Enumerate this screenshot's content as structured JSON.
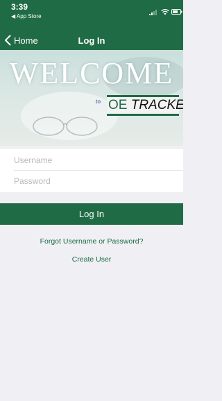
{
  "status_bar": {
    "time": "3:39",
    "back_to_app": "◀ App Store"
  },
  "navbar": {
    "back_label": "Home",
    "title": "Log In"
  },
  "hero": {
    "welcome": "WELCOME",
    "to": "to",
    "brand_prefix": "OE",
    "brand_suffix": " TRACKER"
  },
  "form": {
    "username_placeholder": "Username",
    "password_placeholder": "Password",
    "login_label": "Log In"
  },
  "links": {
    "forgot": "Forgot Username or Password?",
    "create": "Create User"
  },
  "colors": {
    "brand_green": "#1f6b45",
    "background": "#efeff4"
  }
}
